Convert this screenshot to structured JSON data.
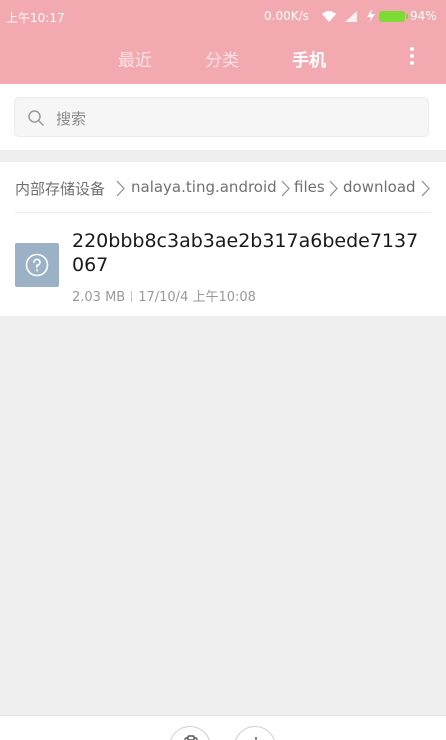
{
  "status_bar": {
    "time": "上午10:17",
    "net_speed": "0.00K/s",
    "battery_pct": "94%",
    "battery_level": 0.94,
    "battery_color": "#7ddb35"
  },
  "tabs": [
    {
      "label": "最近",
      "active": false
    },
    {
      "label": "分类",
      "active": false
    },
    {
      "label": "手机",
      "active": true
    }
  ],
  "header": {
    "color": "#f3a9b0",
    "menu_icon": "more-vertical-icon"
  },
  "search": {
    "placeholder": "搜索",
    "icon": "search-icon"
  },
  "breadcrumb": {
    "items": [
      "内部存储设备",
      "nalaya.ting.android",
      "files",
      "download"
    ],
    "separator_icon": "chevron-right-icon"
  },
  "files": [
    {
      "name": "220bbb8c3ab3ae2b317a6bede7137067",
      "size": "2.03 MB",
      "date": "17/10/4 上午10:08",
      "icon": "unknown-file-icon",
      "icon_color": "#9bb1c6"
    }
  ],
  "bottom_bar": {
    "buttons": [
      "paste-icon",
      "new-folder-icon"
    ]
  }
}
